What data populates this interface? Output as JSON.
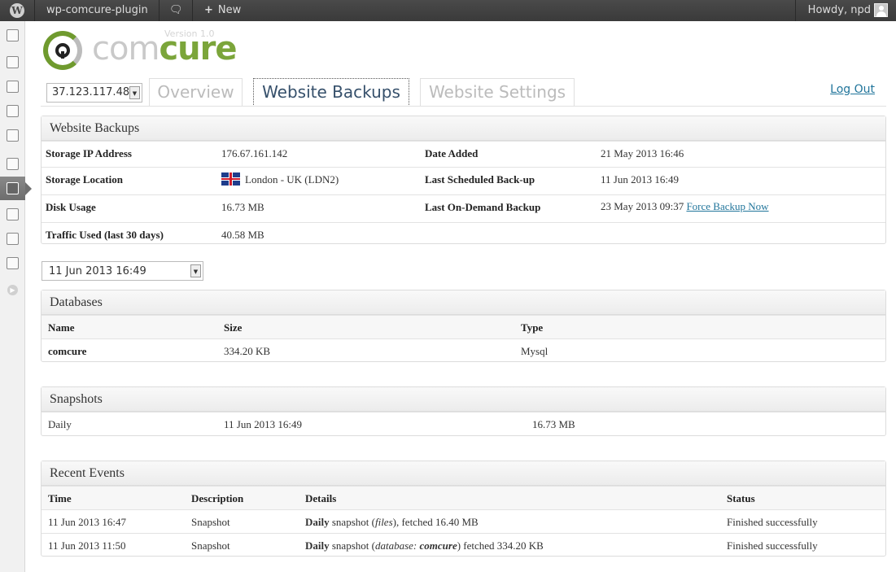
{
  "adminbar": {
    "site_name": "wp-comcure-plugin",
    "new_label": "New",
    "howdy": "Howdy, npd"
  },
  "logo": {
    "word_light": "com",
    "word_strong": "cure",
    "version": "Version 1.0"
  },
  "toolbar": {
    "ip_select_value": "37.123.117.48",
    "tabs": [
      "Overview",
      "Website Backups",
      "Website Settings"
    ],
    "active_tab": "Website Backups",
    "logout_label": "Log Out"
  },
  "info": {
    "title": "Website Backups",
    "rows": [
      {
        "label": "Storage IP Address",
        "value": "176.67.161.142",
        "label2": "Date Added",
        "value2": "21 May 2013 16:46"
      },
      {
        "label": "Storage Location",
        "value": "London - UK (LDN2)",
        "label2": "Last Scheduled Back-up",
        "value2": "11 Jun 2013 16:49"
      },
      {
        "label": "Disk Usage",
        "value": "16.73 MB",
        "label2": "Last On-Demand Backup",
        "value2": "23 May 2013 09:37"
      },
      {
        "label": "Traffic Used (last 30 days)",
        "value": "40.58 MB"
      }
    ],
    "force_backup_label": "Force Backup Now"
  },
  "snapshot_select_value": "11 Jun 2013 16:49",
  "databases": {
    "title": "Databases",
    "headers": [
      "Name",
      "Size",
      "Type"
    ],
    "rows": [
      [
        "comcure",
        "334.20 KB",
        "Mysql"
      ]
    ]
  },
  "snapshots": {
    "title": "Snapshots",
    "rows": [
      [
        "Daily",
        "11 Jun 2013 16:49",
        "16.73 MB"
      ]
    ]
  },
  "events": {
    "title": "Recent Events",
    "headers": [
      "Time",
      "Description",
      "Details",
      "Status"
    ],
    "rows": [
      {
        "time": "11 Jun 2013 16:47",
        "description": "Snapshot",
        "details_bold": "Daily",
        "details_a": " snapshot (",
        "details_italic": "files",
        "details_b": "), fetched 16.40 MB",
        "status": "Finished successfully"
      },
      {
        "time": "11 Jun 2013 11:50",
        "description": "Snapshot",
        "details_bold": "Daily",
        "details_a": " snapshot (",
        "details_italic": "database: ",
        "details_bolditalic": "comcure",
        "details_b": ") fetched 334.20 KB",
        "status": "Finished successfully"
      }
    ]
  }
}
